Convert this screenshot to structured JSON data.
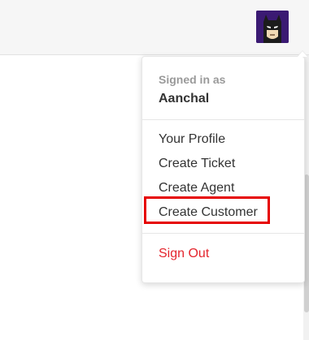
{
  "header": {
    "avatar_icon": "batman-avatar-icon",
    "avatar_bg": "#3b1a73"
  },
  "dropdown": {
    "signed_in_label": "Signed in as",
    "user_name": "Aanchal",
    "items": [
      {
        "label": "Your Profile"
      },
      {
        "label": "Create Ticket"
      },
      {
        "label": "Create Agent"
      },
      {
        "label": "Create Customer"
      }
    ],
    "sign_out_label": "Sign Out",
    "highlight_color": "#e60000",
    "sign_out_color": "#e4252d"
  }
}
